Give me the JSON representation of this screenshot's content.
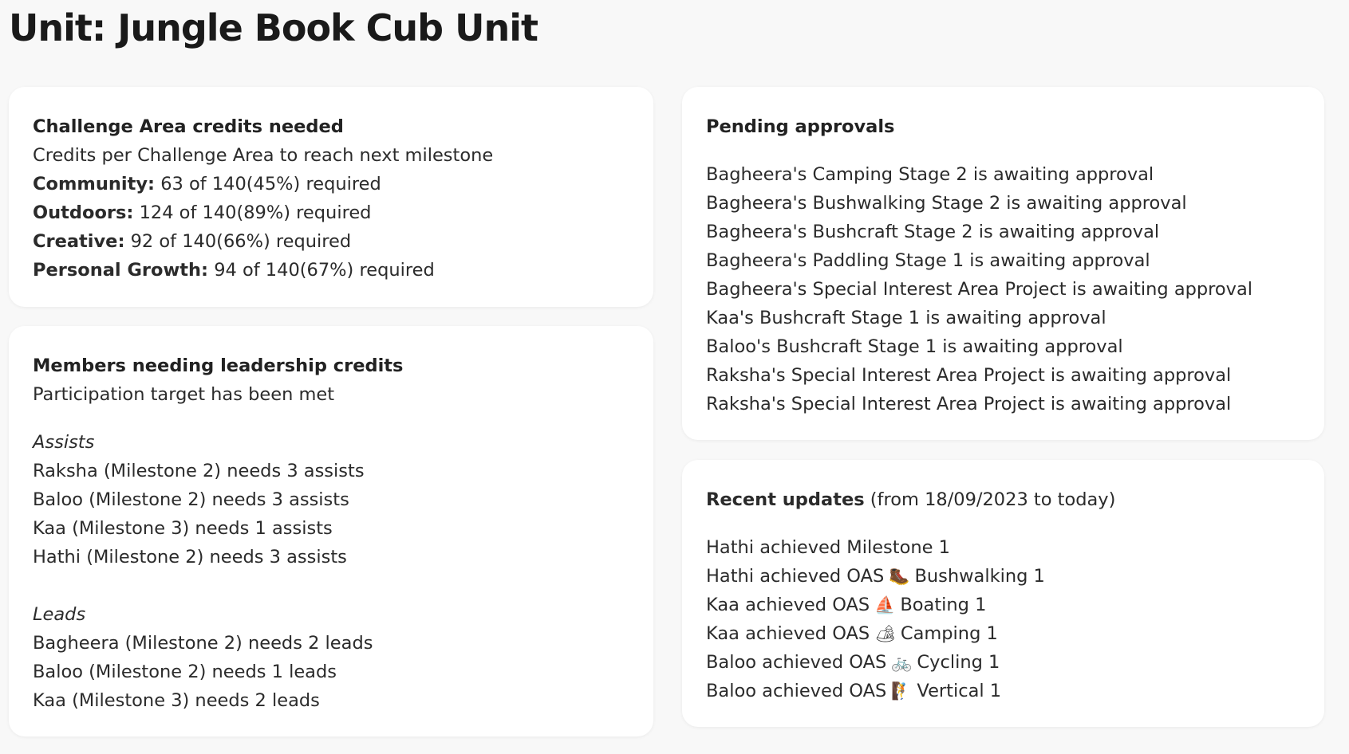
{
  "page_title": "Unit: Jungle Book Cub Unit",
  "challenge_area": {
    "heading": "Challenge Area credits needed",
    "subtitle": "Credits per Challenge Area to reach next milestone",
    "rows": [
      {
        "label": "Community:",
        "value": "63 of 140(45%) required"
      },
      {
        "label": "Outdoors:",
        "value": "124 of 140(89%) required"
      },
      {
        "label": "Creative:",
        "value": "92 of 140(66%) required"
      },
      {
        "label": "Personal Growth:",
        "value": "94 of 140(67%) required"
      }
    ]
  },
  "leadership": {
    "heading": "Members needing leadership credits",
    "subtitle": "Participation target has been met",
    "assists_label": "Assists",
    "assists": [
      "Raksha (Milestone 2) needs 3 assists",
      "Baloo (Milestone 2) needs 3 assists",
      "Kaa (Milestone 3) needs 1 assists",
      "Hathi (Milestone 2) needs 3 assists"
    ],
    "leads_label": "Leads",
    "leads": [
      "Bagheera (Milestone 2) needs 2 leads",
      "Baloo (Milestone 2) needs 1 leads",
      "Kaa (Milestone 3) needs 2 leads"
    ]
  },
  "pending": {
    "heading": "Pending approvals",
    "items": [
      "Bagheera's Camping Stage 2 is awaiting approval",
      "Bagheera's Bushwalking Stage 2 is awaiting approval",
      "Bagheera's Bushcraft Stage 2 is awaiting approval",
      "Bagheera's Paddling Stage 1 is awaiting approval",
      "Bagheera's Special Interest Area Project is awaiting approval",
      "Kaa's Bushcraft Stage 1 is awaiting approval",
      "Baloo's Bushcraft Stage 1 is awaiting approval",
      "Raksha's Special Interest Area Project is awaiting approval",
      "Raksha's Special Interest Area Project is awaiting approval"
    ]
  },
  "recent": {
    "heading": "Recent updates",
    "range": "(from 18/09/2023 to today)",
    "items": [
      {
        "prefix": "Hathi achieved Milestone 1",
        "icon": "",
        "icon_name": "",
        "suffix": ""
      },
      {
        "prefix": "Hathi achieved OAS",
        "icon": "🥾",
        "icon_name": "hiking-boot-icon",
        "suffix": "Bushwalking 1"
      },
      {
        "prefix": "Kaa achieved OAS",
        "icon": "⛵",
        "icon_name": "sailboat-icon",
        "suffix": "Boating 1"
      },
      {
        "prefix": "Kaa achieved OAS",
        "icon": "🏕",
        "icon_name": "tent-icon",
        "suffix": "Camping 1"
      },
      {
        "prefix": "Baloo achieved OAS",
        "icon": "🚲",
        "icon_name": "bicycle-icon",
        "suffix": "Cycling 1"
      },
      {
        "prefix": "Baloo achieved OAS",
        "icon": "🧗",
        "icon_name": "climber-icon",
        "suffix": "Vertical 1"
      }
    ]
  }
}
